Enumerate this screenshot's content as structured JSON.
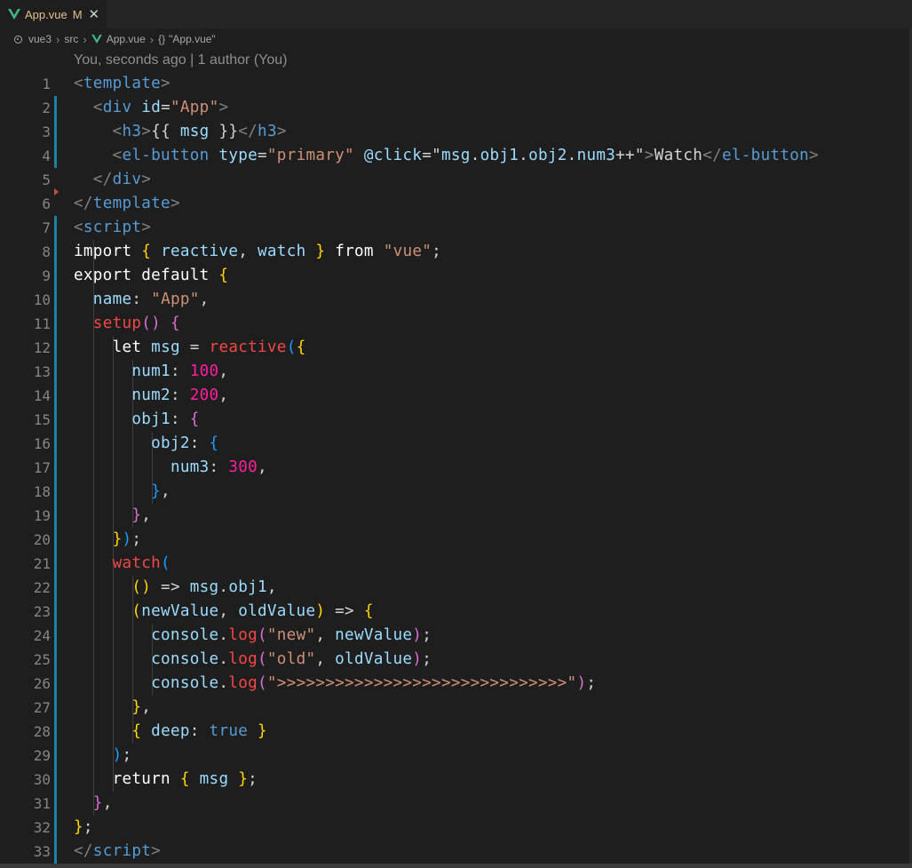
{
  "tab": {
    "filename": "App.vue",
    "status": "M"
  },
  "breadcrumb": [
    "vue3",
    "src",
    "App.vue",
    "\"App.vue\""
  ],
  "blame": "You, seconds ago | 1 author (You)",
  "lines": [
    [
      [
        "br",
        "<"
      ],
      [
        "tg",
        "template"
      ],
      [
        "br",
        ">"
      ]
    ],
    [
      [
        "pl",
        "  "
      ],
      [
        "br",
        "<"
      ],
      [
        "tg",
        "div"
      ],
      [
        "pl",
        " "
      ],
      [
        "at",
        "id"
      ],
      [
        "pl",
        "="
      ],
      [
        "st",
        "\"App\""
      ],
      [
        "br",
        ">"
      ]
    ],
    [
      [
        "pl",
        "    "
      ],
      [
        "br",
        "<"
      ],
      [
        "tg",
        "h3"
      ],
      [
        "br",
        ">"
      ],
      [
        "pl",
        "{{ "
      ],
      [
        "vr",
        "msg"
      ],
      [
        "pl",
        " }}"
      ],
      [
        "br",
        "</"
      ],
      [
        "tg",
        "h3"
      ],
      [
        "br",
        ">"
      ]
    ],
    [
      [
        "pl",
        "    "
      ],
      [
        "br",
        "<"
      ],
      [
        "tg",
        "el-button"
      ],
      [
        "pl",
        " "
      ],
      [
        "at",
        "type"
      ],
      [
        "pl",
        "="
      ],
      [
        "st",
        "\"primary\""
      ],
      [
        "pl",
        " "
      ],
      [
        "at",
        "@click"
      ],
      [
        "pl",
        "=\""
      ],
      [
        "vr",
        "msg"
      ],
      [
        "pl",
        "."
      ],
      [
        "vr",
        "obj1"
      ],
      [
        "pl",
        "."
      ],
      [
        "vr",
        "obj2"
      ],
      [
        "pl",
        "."
      ],
      [
        "vr",
        "num3"
      ],
      [
        "pl",
        "++\""
      ],
      [
        "br",
        ">"
      ],
      [
        "pl",
        "Watch"
      ],
      [
        "br",
        "</"
      ],
      [
        "tg",
        "el-button"
      ],
      [
        "br",
        ">"
      ]
    ],
    [
      [
        "pl",
        "  "
      ],
      [
        "br",
        "</"
      ],
      [
        "tg",
        "div"
      ],
      [
        "br",
        ">"
      ]
    ],
    [
      [
        "br",
        "</"
      ],
      [
        "tg",
        "template"
      ],
      [
        "br",
        ">"
      ]
    ],
    [
      [
        "br",
        "<"
      ],
      [
        "tg",
        "script"
      ],
      [
        "br",
        ">"
      ]
    ],
    [
      [
        "kw",
        "import"
      ],
      [
        "pl",
        " "
      ],
      [
        "b1",
        "{"
      ],
      [
        "pl",
        " "
      ],
      [
        "vr",
        "reactive"
      ],
      [
        "pl",
        ", "
      ],
      [
        "vr",
        "watch"
      ],
      [
        "pl",
        " "
      ],
      [
        "b1",
        "}"
      ],
      [
        "pl",
        " "
      ],
      [
        "kw",
        "from"
      ],
      [
        "pl",
        " "
      ],
      [
        "st",
        "\"vue\""
      ],
      [
        "pl",
        ";"
      ]
    ],
    [
      [
        "kw",
        "export"
      ],
      [
        "pl",
        " "
      ],
      [
        "kw",
        "default"
      ],
      [
        "pl",
        " "
      ],
      [
        "b1",
        "{"
      ]
    ],
    [
      [
        "pl",
        "  "
      ],
      [
        "at",
        "name"
      ],
      [
        "pl",
        ": "
      ],
      [
        "st",
        "\"App\""
      ],
      [
        "pl",
        ","
      ]
    ],
    [
      [
        "pl",
        "  "
      ],
      [
        "fn",
        "setup"
      ],
      [
        "b2",
        "()"
      ],
      [
        "pl",
        " "
      ],
      [
        "b2",
        "{"
      ]
    ],
    [
      [
        "pl",
        "    "
      ],
      [
        "kw",
        "let"
      ],
      [
        "pl",
        " "
      ],
      [
        "vr",
        "msg"
      ],
      [
        "pl",
        " = "
      ],
      [
        "fn",
        "reactive"
      ],
      [
        "b3",
        "("
      ],
      [
        "b1",
        "{"
      ]
    ],
    [
      [
        "pl",
        "      "
      ],
      [
        "at",
        "num1"
      ],
      [
        "pl",
        ": "
      ],
      [
        "nu",
        "100"
      ],
      [
        "pl",
        ","
      ]
    ],
    [
      [
        "pl",
        "      "
      ],
      [
        "at",
        "num2"
      ],
      [
        "pl",
        ": "
      ],
      [
        "nu",
        "200"
      ],
      [
        "pl",
        ","
      ]
    ],
    [
      [
        "pl",
        "      "
      ],
      [
        "at",
        "obj1"
      ],
      [
        "pl",
        ": "
      ],
      [
        "b2",
        "{"
      ]
    ],
    [
      [
        "pl",
        "        "
      ],
      [
        "at",
        "obj2"
      ],
      [
        "pl",
        ": "
      ],
      [
        "b3",
        "{"
      ]
    ],
    [
      [
        "pl",
        "          "
      ],
      [
        "at",
        "num3"
      ],
      [
        "pl",
        ": "
      ],
      [
        "nu",
        "300"
      ],
      [
        "pl",
        ","
      ]
    ],
    [
      [
        "pl",
        "        "
      ],
      [
        "b3",
        "}"
      ],
      [
        "pl",
        ","
      ]
    ],
    [
      [
        "pl",
        "      "
      ],
      [
        "b2",
        "}"
      ],
      [
        "pl",
        ","
      ]
    ],
    [
      [
        "pl",
        "    "
      ],
      [
        "b1",
        "}"
      ],
      [
        "b3",
        ")"
      ],
      [
        "pl",
        ";"
      ]
    ],
    [
      [
        "pl",
        "    "
      ],
      [
        "fn",
        "watch"
      ],
      [
        "b3",
        "("
      ]
    ],
    [
      [
        "pl",
        "      "
      ],
      [
        "b1",
        "()"
      ],
      [
        "pl",
        " => "
      ],
      [
        "vr",
        "msg"
      ],
      [
        "pl",
        "."
      ],
      [
        "vr",
        "obj1"
      ],
      [
        "pl",
        ","
      ]
    ],
    [
      [
        "pl",
        "      "
      ],
      [
        "b1",
        "("
      ],
      [
        "vr",
        "newValue"
      ],
      [
        "pl",
        ", "
      ],
      [
        "vr",
        "oldValue"
      ],
      [
        "b1",
        ")"
      ],
      [
        "pl",
        " => "
      ],
      [
        "b1",
        "{"
      ]
    ],
    [
      [
        "pl",
        "        "
      ],
      [
        "at",
        "console"
      ],
      [
        "pl",
        "."
      ],
      [
        "fn",
        "log"
      ],
      [
        "b2",
        "("
      ],
      [
        "st",
        "\"new\""
      ],
      [
        "pl",
        ", "
      ],
      [
        "vr",
        "newValue"
      ],
      [
        "b2",
        ")"
      ],
      [
        "pl",
        ";"
      ]
    ],
    [
      [
        "pl",
        "        "
      ],
      [
        "at",
        "console"
      ],
      [
        "pl",
        "."
      ],
      [
        "fn",
        "log"
      ],
      [
        "b2",
        "("
      ],
      [
        "st",
        "\"old\""
      ],
      [
        "pl",
        ", "
      ],
      [
        "vr",
        "oldValue"
      ],
      [
        "b2",
        ")"
      ],
      [
        "pl",
        ";"
      ]
    ],
    [
      [
        "pl",
        "        "
      ],
      [
        "at",
        "console"
      ],
      [
        "pl",
        "."
      ],
      [
        "fn",
        "log"
      ],
      [
        "b2",
        "("
      ],
      [
        "st",
        "\">>>>>>>>>>>>>>>>>>>>>>>>>>>>>>\""
      ],
      [
        "b2",
        ")"
      ],
      [
        "pl",
        ";"
      ]
    ],
    [
      [
        "pl",
        "      "
      ],
      [
        "b1",
        "}"
      ],
      [
        "pl",
        ","
      ]
    ],
    [
      [
        "pl",
        "      "
      ],
      [
        "b1",
        "{"
      ],
      [
        "pl",
        " "
      ],
      [
        "at",
        "deep"
      ],
      [
        "pl",
        ": "
      ],
      [
        "cb",
        "true"
      ],
      [
        "pl",
        " "
      ],
      [
        "b1",
        "}"
      ]
    ],
    [
      [
        "pl",
        "    "
      ],
      [
        "b3",
        ")"
      ],
      [
        "pl",
        ";"
      ]
    ],
    [
      [
        "pl",
        "    "
      ],
      [
        "kw",
        "return"
      ],
      [
        "pl",
        " "
      ],
      [
        "b1",
        "{"
      ],
      [
        "pl",
        " "
      ],
      [
        "vr",
        "msg"
      ],
      [
        "pl",
        " "
      ],
      [
        "b1",
        "}"
      ],
      [
        "pl",
        ";"
      ]
    ],
    [
      [
        "pl",
        "  "
      ],
      [
        "b2",
        "}"
      ],
      [
        "pl",
        ","
      ]
    ],
    [
      [
        "b1",
        "}"
      ],
      [
        "pl",
        ";"
      ]
    ],
    [
      [
        "br",
        "</"
      ],
      [
        "tg",
        "script"
      ],
      [
        "br",
        ">"
      ]
    ]
  ]
}
